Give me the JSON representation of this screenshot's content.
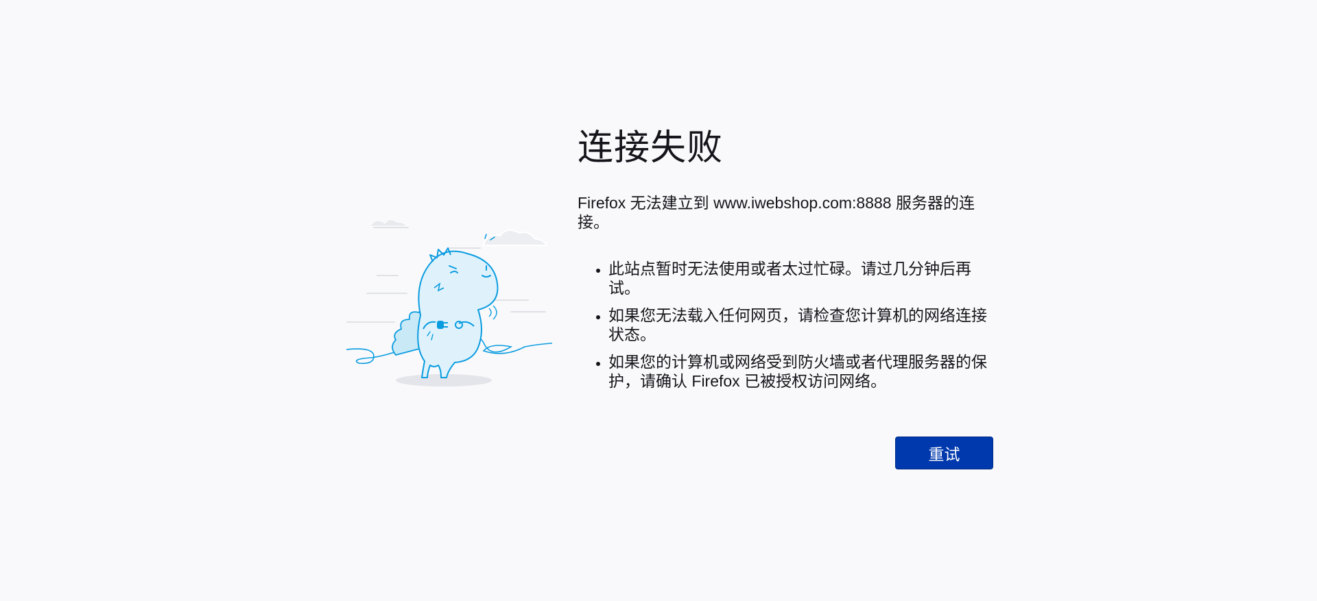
{
  "error": {
    "title": "连接失败",
    "intro": "Firefox 无法建立到 www.iwebshop.com:8888 服务器的连接。",
    "tips": [
      "此站点暂时无法使用或者太过忙碌。请过几分钟后再试。",
      "如果您无法载入任何网页，请检查您计算机的网络连接状态。",
      "如果您的计算机或网络受到防火墙或者代理服务器的保护，请确认 Firefox 已被授权访问网络。"
    ]
  },
  "actions": {
    "retry_label": "重试"
  },
  "colors": {
    "background": "#f9f9fb",
    "button": "#0039ad",
    "illustration": "#0a9ce0"
  }
}
